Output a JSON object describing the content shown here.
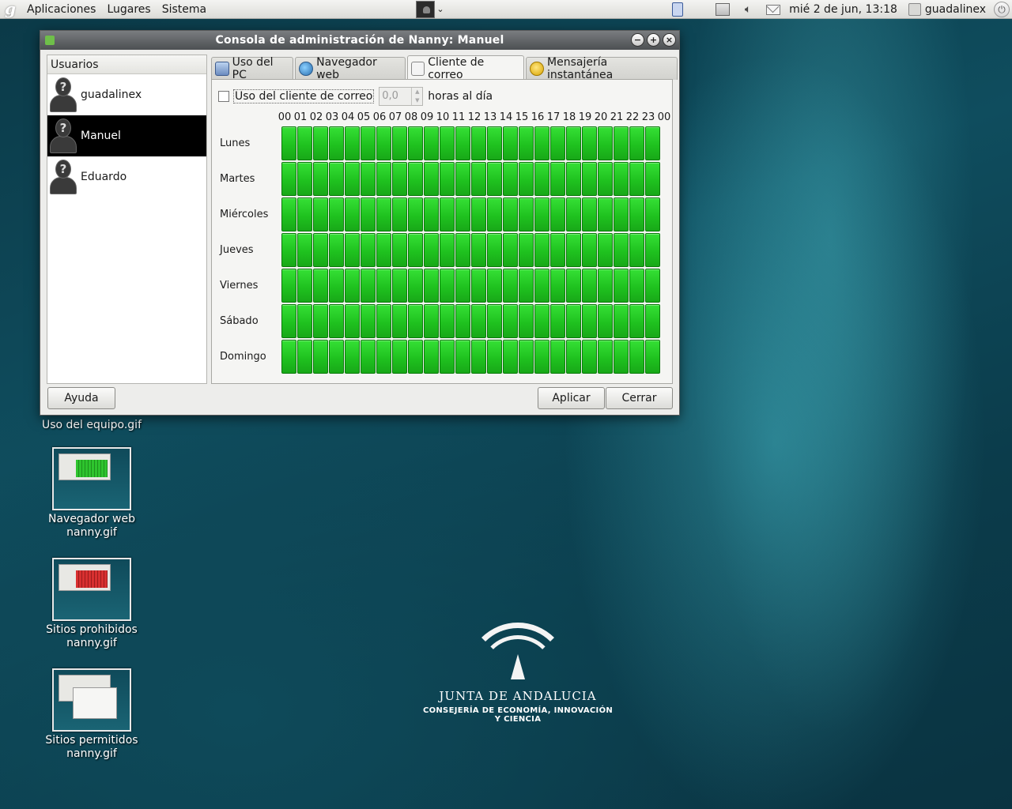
{
  "top_panel": {
    "menus": [
      "Aplicaciones",
      "Lugares",
      "Sistema"
    ],
    "clock": "mié  2 de jun, 13:18",
    "user": "guadalinex"
  },
  "desktop_icons": [
    {
      "label": "Uso del equipo.gif"
    },
    {
      "label": "Navegador web nanny.gif"
    },
    {
      "label": "Sitios prohibidos nanny.gif"
    },
    {
      "label": "Sitios permitidos nanny.gif"
    }
  ],
  "logo": {
    "name": "JUNTA DE ANDALUCIA",
    "subtitle": "CONSEJERÍA DE ECONOMÍA, INNOVACIÓN Y CIENCIA"
  },
  "dialog": {
    "title": "Consola de administración de Nanny: Manuel",
    "users_header": "Usuarios",
    "users": [
      {
        "name": "guadalinex",
        "selected": false
      },
      {
        "name": "Manuel",
        "selected": true
      },
      {
        "name": "Eduardo",
        "selected": false
      }
    ],
    "tabs": [
      {
        "label": "Uso del PC",
        "icon": "computer-icon",
        "active": false
      },
      {
        "label": "Navegador web",
        "icon": "globe-icon",
        "active": false
      },
      {
        "label": "Cliente de correo",
        "icon": "mail-icon",
        "active": true
      },
      {
        "label": "Mensajería instantánea",
        "icon": "chat-icon",
        "active": false
      }
    ],
    "limit_checkbox_label": "Uso del cliente de correo",
    "limit_checked": false,
    "hours_value": "0,0",
    "hours_suffix": "horas al día",
    "hour_labels": [
      "00",
      "01",
      "02",
      "03",
      "04",
      "05",
      "06",
      "07",
      "08",
      "09",
      "10",
      "11",
      "12",
      "13",
      "14",
      "15",
      "16",
      "17",
      "18",
      "19",
      "20",
      "21",
      "22",
      "23",
      "00"
    ],
    "days": [
      "Lunes",
      "Martes",
      "Miércoles",
      "Jueves",
      "Viernes",
      "Sábado",
      "Domingo"
    ],
    "slot_state": "allowed",
    "allowed_color": "#22c822",
    "help_button": "Ayuda",
    "apply_button": "Aplicar",
    "close_button": "Cerrar"
  }
}
